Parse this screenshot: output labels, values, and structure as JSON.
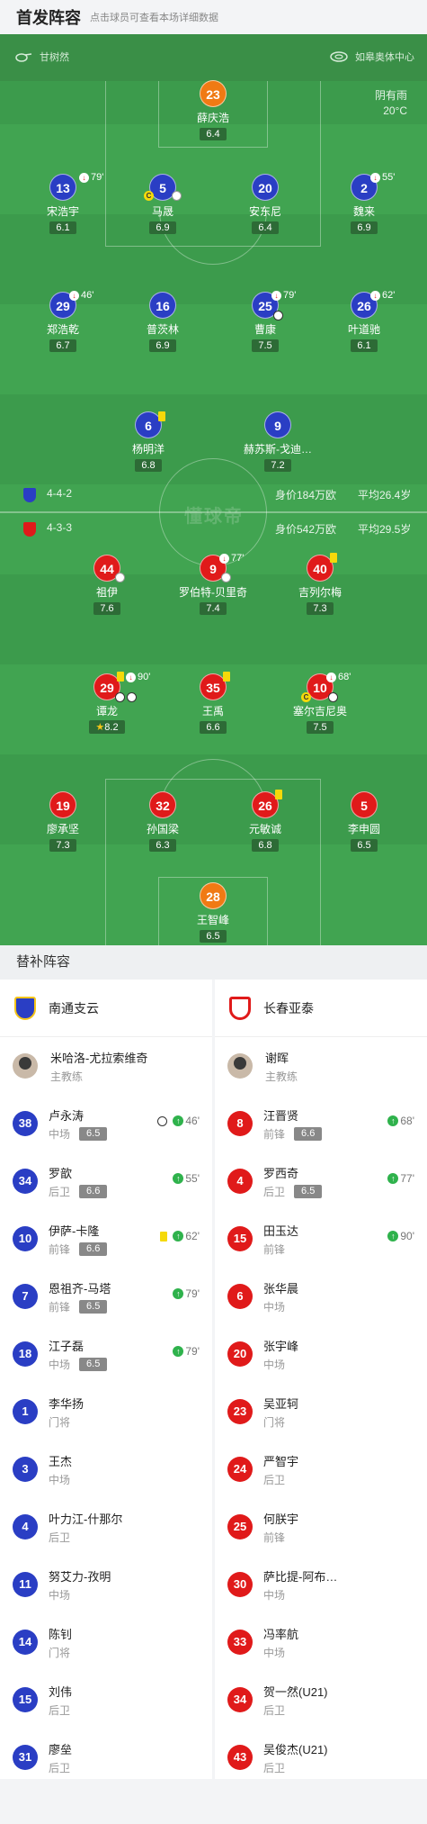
{
  "header": {
    "title": "首发阵容",
    "subtitle": "点击球员可查看本场详细数据"
  },
  "pitch": {
    "referee": "甘树然",
    "venue": "如皋奥体中心",
    "weather": "阴有雨",
    "temperature": "20°C",
    "watermark": "懂球帝"
  },
  "home": {
    "name": "南通支云",
    "formation": "4-4-2",
    "value": "身价184万欧",
    "avg_age": "平均26.4岁",
    "color": "#2a3ec4",
    "lineup": [
      {
        "num": "23",
        "name": "薛庆浩",
        "rating": "6.4"
      },
      {
        "num": "13",
        "name": "宋浩宇",
        "rating": "6.1",
        "sub_out": "79'"
      },
      {
        "num": "5",
        "name": "马晟",
        "rating": "6.9"
      },
      {
        "num": "20",
        "name": "安东尼",
        "rating": "6.4"
      },
      {
        "num": "2",
        "name": "魏来",
        "rating": "6.9",
        "sub_out": "55'"
      },
      {
        "num": "29",
        "name": "郑浩乾",
        "rating": "6.7",
        "sub_out": "46'"
      },
      {
        "num": "16",
        "name": "普茨林",
        "rating": "6.9"
      },
      {
        "num": "25",
        "name": "曹康",
        "rating": "7.5",
        "sub_out": "79'"
      },
      {
        "num": "26",
        "name": "叶道驰",
        "rating": "6.1",
        "sub_out": "62'"
      },
      {
        "num": "6",
        "name": "杨明洋",
        "rating": "6.8"
      },
      {
        "num": "9",
        "name": "赫苏斯-戈迪…",
        "rating": "7.2"
      }
    ]
  },
  "away": {
    "name": "长春亚泰",
    "formation": "4-3-3",
    "value": "身价542万欧",
    "avg_age": "平均29.5岁",
    "color": "#e01a1a",
    "lineup": [
      {
        "num": "44",
        "name": "祖伊",
        "rating": "7.6"
      },
      {
        "num": "9",
        "name": "罗伯特-贝里奇",
        "rating": "7.4",
        "sub_out": "77'"
      },
      {
        "num": "40",
        "name": "吉列尔梅",
        "rating": "7.3"
      },
      {
        "num": "29",
        "name": "谭龙",
        "rating": "8.2",
        "sub_out": "90'"
      },
      {
        "num": "35",
        "name": "王禹",
        "rating": "6.6"
      },
      {
        "num": "10",
        "name": "塞尔吉尼奥",
        "rating": "7.5",
        "sub_out": "68'"
      },
      {
        "num": "19",
        "name": "廖承坚",
        "rating": "7.3"
      },
      {
        "num": "32",
        "name": "孙国梁",
        "rating": "6.3"
      },
      {
        "num": "26",
        "name": "元敏诚",
        "rating": "6.8"
      },
      {
        "num": "5",
        "name": "李申圆",
        "rating": "6.5"
      },
      {
        "num": "28",
        "name": "王智峰",
        "rating": "6.5"
      }
    ]
  },
  "subs": {
    "title": "替补阵容",
    "home_coach": {
      "name": "米哈洛-尤拉索维奇",
      "role": "主教练"
    },
    "away_coach": {
      "name": "谢晖",
      "role": "主教练"
    },
    "home": [
      {
        "num": "38",
        "name": "卢永涛",
        "pos": "中场",
        "rating": "6.5",
        "time": "46'"
      },
      {
        "num": "34",
        "name": "罗歆",
        "pos": "后卫",
        "rating": "6.6",
        "time": "55'"
      },
      {
        "num": "10",
        "name": "伊萨-卡隆",
        "pos": "前锋",
        "rating": "6.6",
        "time": "62'"
      },
      {
        "num": "7",
        "name": "恩祖齐-马塔",
        "pos": "前锋",
        "rating": "6.5",
        "time": "79'"
      },
      {
        "num": "18",
        "name": "江子磊",
        "pos": "中场",
        "rating": "6.5",
        "time": "79'"
      },
      {
        "num": "1",
        "name": "李华扬",
        "pos": "门将"
      },
      {
        "num": "3",
        "name": "王杰",
        "pos": "中场"
      },
      {
        "num": "4",
        "name": "叶力江-什那尔",
        "pos": "后卫"
      },
      {
        "num": "11",
        "name": "努艾力-孜明",
        "pos": "中场"
      },
      {
        "num": "14",
        "name": "陈钊",
        "pos": "门将"
      },
      {
        "num": "15",
        "name": "刘伟",
        "pos": "后卫"
      },
      {
        "num": "31",
        "name": "廖垒",
        "pos": "后卫"
      }
    ],
    "away": [
      {
        "num": "8",
        "name": "汪晋贤",
        "pos": "前锋",
        "rating": "6.6",
        "time": "68'"
      },
      {
        "num": "4",
        "name": "罗西奇",
        "pos": "后卫",
        "rating": "6.5",
        "time": "77'"
      },
      {
        "num": "15",
        "name": "田玉达",
        "pos": "前锋",
        "time": "90'"
      },
      {
        "num": "6",
        "name": "张华晨",
        "pos": "中场"
      },
      {
        "num": "20",
        "name": "张宇峰",
        "pos": "中场"
      },
      {
        "num": "23",
        "name": "吴亚轲",
        "pos": "门将"
      },
      {
        "num": "24",
        "name": "严智宇",
        "pos": "后卫"
      },
      {
        "num": "25",
        "name": "何朕宇",
        "pos": "前锋"
      },
      {
        "num": "30",
        "name": "萨比提-阿布…",
        "pos": "中场"
      },
      {
        "num": "33",
        "name": "冯率航",
        "pos": "中场"
      },
      {
        "num": "34",
        "name": "贺一然(U21)",
        "pos": "后卫"
      },
      {
        "num": "43",
        "name": "吴俊杰(U21)",
        "pos": "后卫"
      }
    ]
  }
}
